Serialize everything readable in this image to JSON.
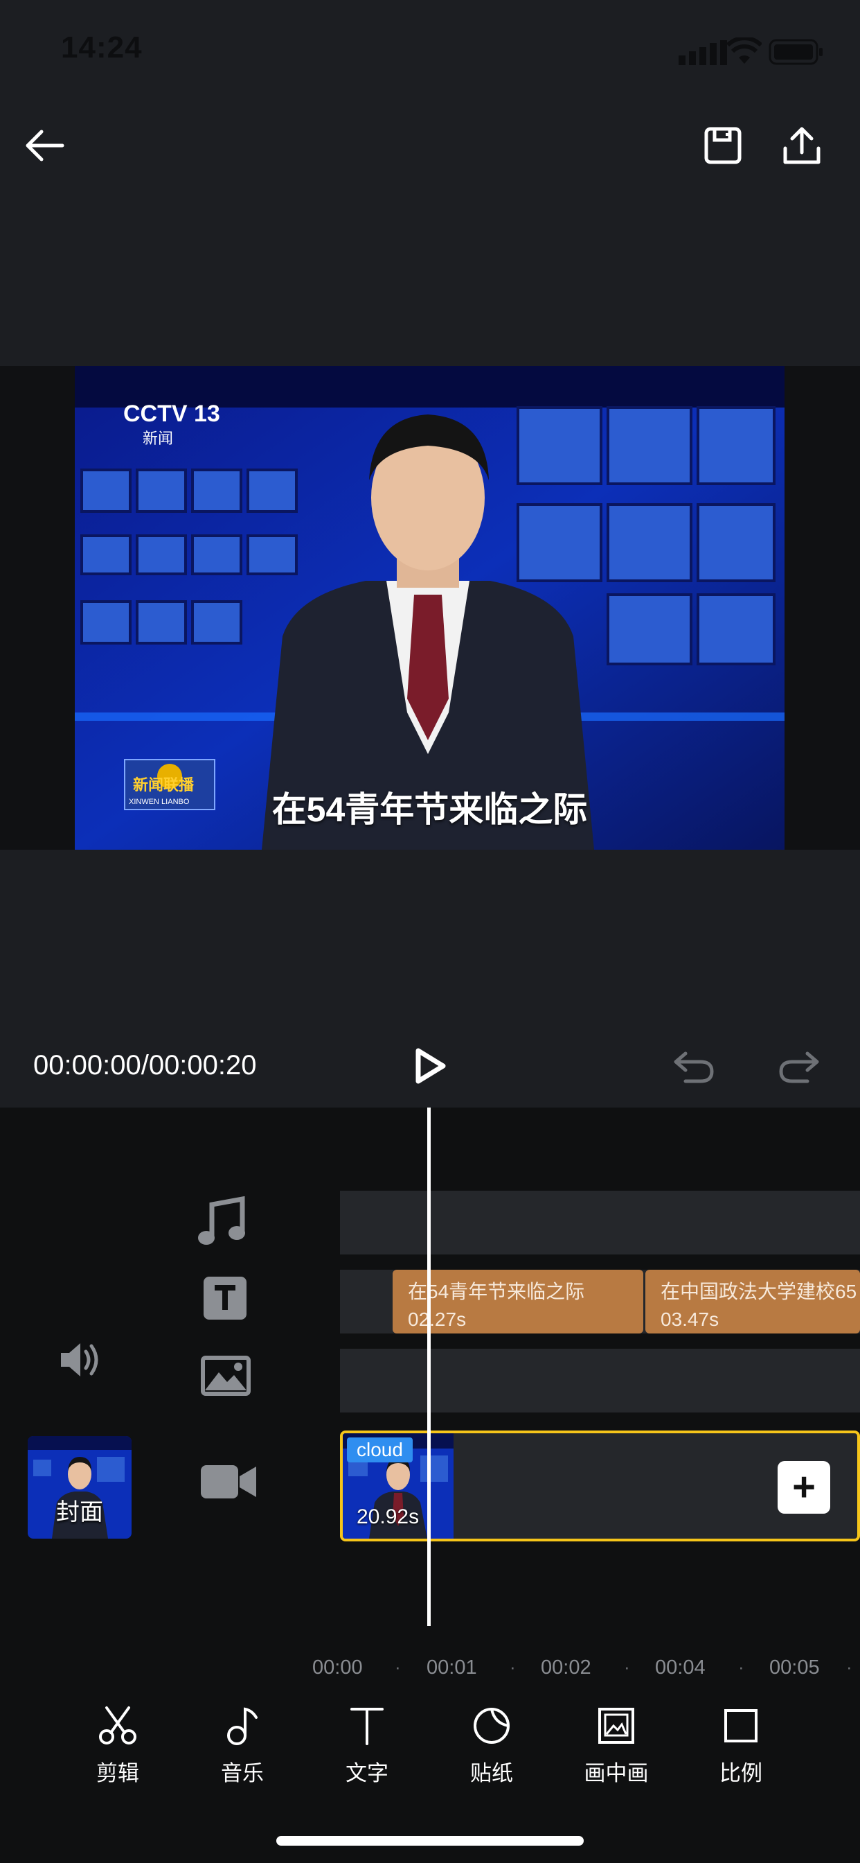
{
  "status_bar": {
    "time": "14:24"
  },
  "player": {
    "subtitle": "在54青年节来临之际",
    "timecode": "00:00:00/00:00:20",
    "channel_logo": "CCTV 13",
    "channel_sub": "新闻",
    "program_logo": "新闻联播",
    "program_logo_sub": "XINWEN LIANBO"
  },
  "timeline": {
    "cover_label": "封面",
    "text_clips": [
      {
        "text": "在54青年节来临之际",
        "duration": "02.27s"
      },
      {
        "text": "在中国政法大学建校65",
        "duration": "03.47s"
      }
    ],
    "video_clip": {
      "badge": "cloud",
      "duration": "20.92s"
    },
    "add_symbol": "+",
    "ruler": [
      "00:00",
      "00:01",
      "00:02",
      "00:04",
      "00:05"
    ],
    "ruler_dot": "·"
  },
  "toolbar": [
    {
      "label": "剪辑",
      "icon": "scissors-icon"
    },
    {
      "label": "音乐",
      "icon": "music-note-icon"
    },
    {
      "label": "文字",
      "icon": "text-icon"
    },
    {
      "label": "贴纸",
      "icon": "sticker-icon"
    },
    {
      "label": "画中画",
      "icon": "picture-in-picture-icon"
    },
    {
      "label": "比例",
      "icon": "aspect-ratio-icon"
    }
  ],
  "colors": {
    "accent_yellow": "#f6c51a",
    "text_clip": "#b87a42",
    "cloud_badge": "#2f8ef0"
  }
}
